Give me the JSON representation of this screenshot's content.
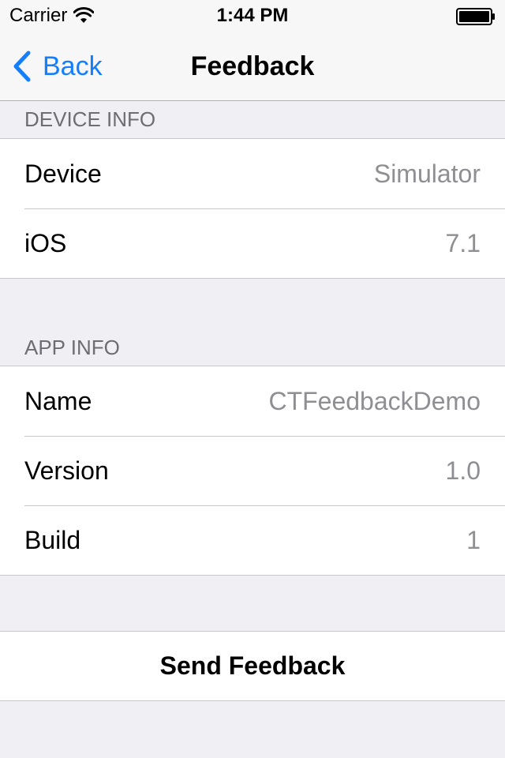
{
  "status_bar": {
    "carrier": "Carrier",
    "time": "1:44 PM",
    "icons": [
      "wifi-icon",
      "battery-icon"
    ]
  },
  "nav": {
    "back_label": "Back",
    "title": "Feedback",
    "accent_color": "#157efb"
  },
  "sections": {
    "device_info": {
      "header": "DEVICE INFO",
      "rows": [
        {
          "label": "Device",
          "value": "Simulator"
        },
        {
          "label": "iOS",
          "value": "7.1"
        }
      ]
    },
    "app_info": {
      "header": "APP INFO",
      "rows": [
        {
          "label": "Name",
          "value": "CTFeedbackDemo"
        },
        {
          "label": "Version",
          "value": "1.0"
        },
        {
          "label": "Build",
          "value": "1"
        }
      ]
    }
  },
  "actions": {
    "send_label": "Send Feedback"
  },
  "colors": {
    "background": "#efeff4",
    "value_text": "#8e8e93",
    "header_text": "#6d6d72"
  }
}
